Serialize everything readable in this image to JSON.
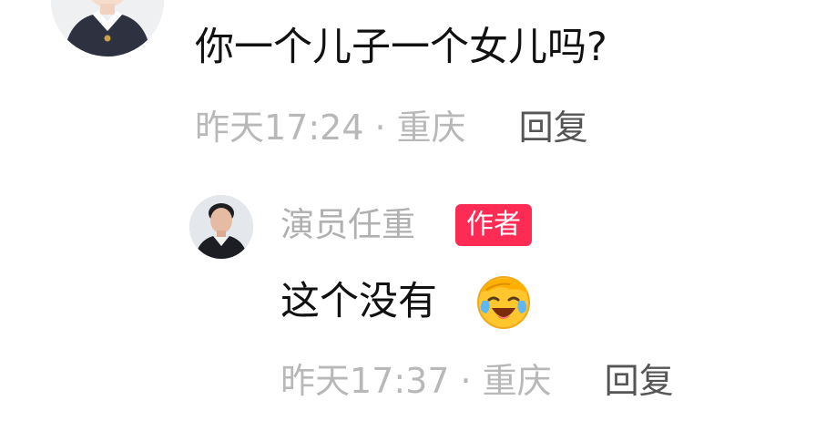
{
  "comment": {
    "text": "你一个儿子一个女儿吗?",
    "time": "昨天17:24",
    "separator": "·",
    "location": "重庆",
    "reply_label": "回复"
  },
  "reply": {
    "username": "演员任重",
    "badge": "作者",
    "text": "这个没有",
    "emoji": "crying-laughing-emoji",
    "time": "昨天17:37",
    "separator": "·",
    "location": "重庆",
    "reply_label": "回复"
  },
  "colors": {
    "badge_bg": "#fe2c55",
    "meta_text": "#b8b8b8",
    "reply_action": "#555555",
    "body_text": "#111111"
  }
}
